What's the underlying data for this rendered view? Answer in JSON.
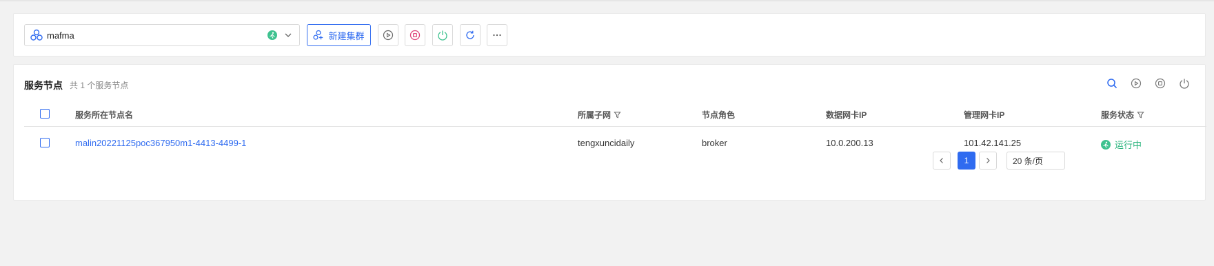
{
  "toolbar": {
    "cluster_name": "mafma",
    "cluster_status_icon": "running-icon",
    "new_cluster_label": "新建集群",
    "actions": [
      "start-icon",
      "stop-icon",
      "power-icon",
      "refresh-icon",
      "more-icon"
    ]
  },
  "section": {
    "title": "服务节点",
    "count_text": "共 1 个服务节点"
  },
  "table": {
    "columns": {
      "node_name": "服务所在节点名",
      "subnet": "所属子网",
      "role": "节点角色",
      "data_nic_ip": "数据网卡IP",
      "mgmt_nic_ip": "管理网卡IP",
      "status": "服务状态"
    },
    "rows": [
      {
        "node_name": "malin20221125poc367950m1-4413-4499-1",
        "subnet": "tengxuncidaily",
        "role": "broker",
        "data_nic_ip": "10.0.200.13",
        "mgmt_nic_ip": "101.42.141.25",
        "status": "运行中"
      }
    ]
  },
  "pagination": {
    "current_page": "1",
    "page_size_label": "20 条/页"
  },
  "colors": {
    "accent": "#2f6bf0",
    "running": "#3ec28f",
    "stop": "#e0457b"
  }
}
